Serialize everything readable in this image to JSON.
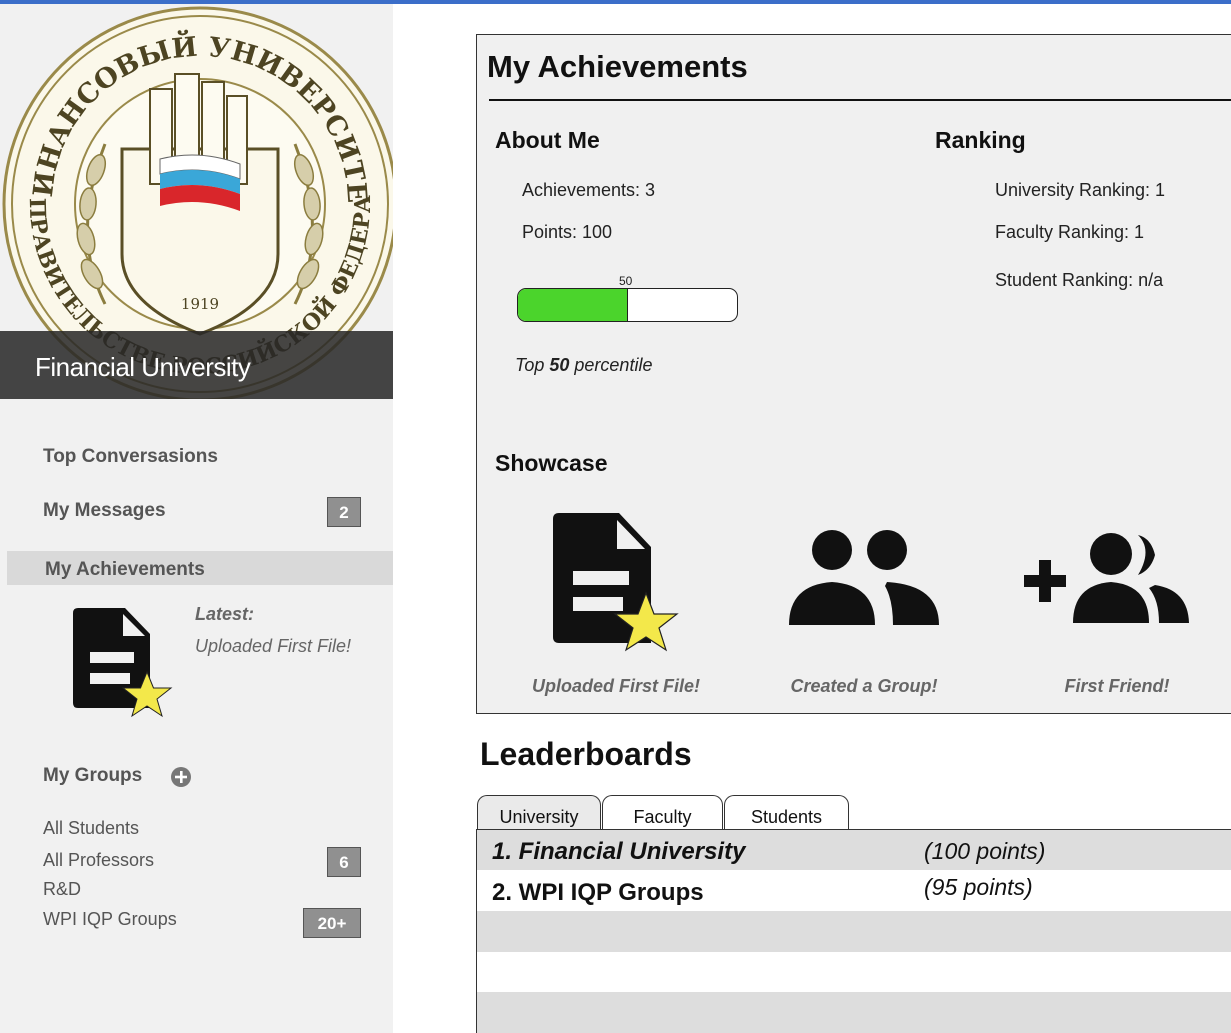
{
  "sidebar": {
    "seal": {
      "top_text": "ФИНАНСОВЫЙ УНИВЕРСИТЕТ",
      "bottom_text": "ПРИ ПРАВИТЕЛЬСТВЕ РОССИЙСКОЙ ФЕДЕРАЦИИ",
      "year": "1919"
    },
    "university_name": "Financial University",
    "nav": {
      "top_conversations": "Top Conversasions",
      "my_messages": "My Messages",
      "my_messages_badge": "2",
      "my_achievements": "My Achievements"
    },
    "latest": {
      "label": "Latest:",
      "value": "Uploaded First File!",
      "icon": "file-star-icon"
    },
    "groups": {
      "title": "My Groups",
      "add_icon": "plus-circle-icon",
      "items": [
        {
          "label": "All Students",
          "badge": ""
        },
        {
          "label": "All Professors",
          "badge": "6"
        },
        {
          "label": "R&D",
          "badge": ""
        },
        {
          "label": "WPI IQP Groups",
          "badge": "20+"
        }
      ]
    }
  },
  "achievements": {
    "title": "My Achievements",
    "about": {
      "heading": "About Me",
      "achievements": "Achievements: 3",
      "points": "Points: 100",
      "progress_value": 50,
      "progress_label": "50",
      "percentile_prefix": "Top ",
      "percentile_value": "50",
      "percentile_suffix": " percentile"
    },
    "ranking": {
      "heading": "Ranking",
      "university": "University Ranking: 1",
      "faculty": "Faculty Ranking: 1",
      "student": "Student Ranking: n/a"
    },
    "showcase": {
      "heading": "Showcase",
      "items": [
        {
          "label": "Uploaded First File!",
          "icon": "file-star-icon"
        },
        {
          "label": "Created a Group!",
          "icon": "group-icon"
        },
        {
          "label": "First Friend!",
          "icon": "add-friend-icon"
        }
      ]
    }
  },
  "leaderboards": {
    "title": "Leaderboards",
    "tabs": [
      "University",
      "Faculty",
      "Students"
    ],
    "active_tab": "University",
    "rows": [
      {
        "rank": "1. Financial University",
        "points": "(100 points)"
      },
      {
        "rank": "2. WPI IQP Groups",
        "points": "(95 points)"
      }
    ]
  },
  "colors": {
    "accent": "#3b6ec9",
    "progress": "#4bd42c",
    "star": "#f3e84a"
  }
}
